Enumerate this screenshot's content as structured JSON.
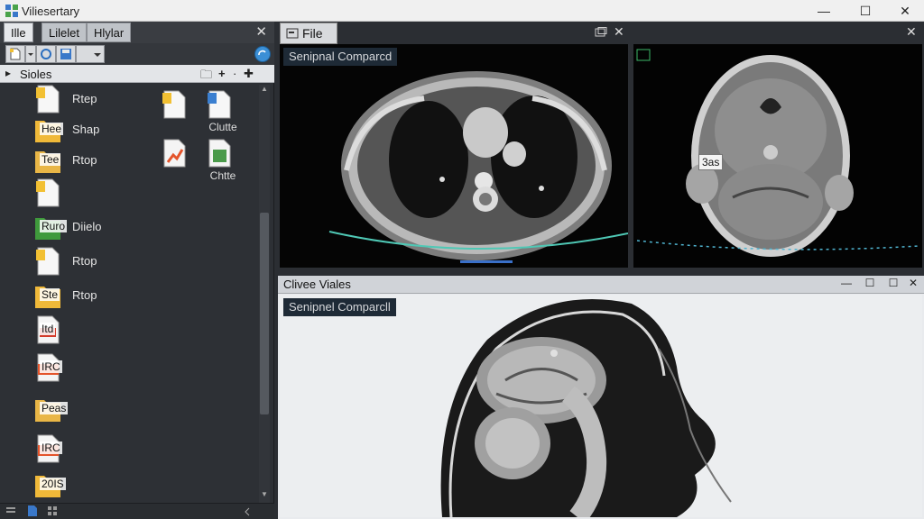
{
  "window": {
    "title": "Viliesertary",
    "minimize": "—",
    "maximize": "☐",
    "close": "✕"
  },
  "left_panel": {
    "tabs": [
      {
        "label": "Ille"
      },
      {
        "label": "Lilelet"
      },
      {
        "label": "Hlylar"
      }
    ],
    "close": "✕",
    "folder_label": "Sioles",
    "folder_arrow": "▸",
    "folder_tools": [
      "🗀",
      "+",
      "·",
      "✚"
    ],
    "files": [
      {
        "tag": "",
        "label": "Rtep",
        "icon": "document-icon",
        "color": "#f2c033"
      },
      {
        "tag": "Hee",
        "label": "Shap",
        "icon": "folder-icon",
        "color": "#f0b93a"
      },
      {
        "tag": "Tee",
        "label": "Rtop",
        "icon": "folder-icon",
        "color": "#e9b647"
      },
      {
        "tag": "",
        "label": "",
        "icon": "document-icon",
        "color": "#f2c033"
      },
      {
        "tag": "Ruro",
        "label": "Diielo",
        "icon": "folder-icon",
        "color": "#3f9a3c"
      },
      {
        "tag": "",
        "label": "Rtop",
        "icon": "document-icon",
        "color": "#f2c033"
      },
      {
        "tag": "Ste",
        "label": "Rtop",
        "icon": "folder-icon",
        "color": "#f0b93a"
      },
      {
        "tag": "Itd",
        "label": "",
        "icon": "pdf-icon",
        "color": "#d9d9d9"
      },
      {
        "tag": "IRC",
        "label": "",
        "icon": "archive-icon",
        "color": "#e4542b"
      },
      {
        "tag": "Peas",
        "label": "",
        "icon": "folder-icon",
        "color": "#e9b647"
      },
      {
        "tag": "IRC",
        "label": "",
        "icon": "archive-icon",
        "color": "#e4542b"
      },
      {
        "tag": "20IS",
        "label": "",
        "icon": "folder-icon",
        "color": "#f0b93a"
      }
    ],
    "grid_items": [
      {
        "label": "",
        "icon": "document-icon",
        "color": "#f2c033"
      },
      {
        "label": "Clutte",
        "icon": "document-icon",
        "color": "#3b7fd0"
      },
      {
        "label": "",
        "icon": "chart-document-icon",
        "color": "#e4542b"
      },
      {
        "label": "Chtte",
        "icon": "spreadsheet-icon",
        "color": "#4a9a4a"
      }
    ]
  },
  "viewer": {
    "tab_label": "File",
    "axial_label": "Senipnal Comparcd",
    "sagittal_title": "Clivee Viales",
    "sagittal_label": "Senipnel Comparcll",
    "annotation": "3as",
    "pane_close": "✕",
    "pane_buttons": [
      "—",
      "☐",
      "✕"
    ]
  }
}
